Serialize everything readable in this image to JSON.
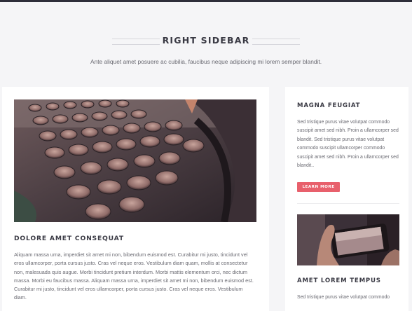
{
  "header": {
    "title": "RIGHT SIDEBAR",
    "subtitle": "Ante aliquet amet posuere ac cubilia, faucibus neque adipiscing mi lorem semper blandit."
  },
  "main": {
    "post_title": "DOLORE AMET CONSEQUAT",
    "post_body": "Aliquam massa urna, imperdiet sit amet mi non, bibendum euismod est. Curabitur mi justo, tincidunt vel eros ullamcorper, porta cursus justo. Cras vel neque eros. Vestibulum diam quam, mollis at consectetur non, malesuada quis augue. Morbi tincidunt pretium interdum. Morbi mattis elementum orci, nec dictum massa. Morbi eu faucibus massa. Aliquam massa urna, imperdiet sit amet mi non, bibendum euismod est. Curabitur mi justo, tincidunt vel eros ullamcorper, porta cursus justo. Cras vel neque eros. Vestibulum diam."
  },
  "sidebar": {
    "widget1": {
      "title": "MAGNA FEUGIAT",
      "text": "Sed tristique purus vitae volutpat commodo suscipit amet sed nibh. Proin a ullamcorper sed blandit. Sed tristique purus vitae volutpat commodo suscipit ullamcorper commodo suscipit amet sed nibh. Proin a ullamcorper sed blandit..",
      "button_label": "LEARN MORE"
    },
    "widget2": {
      "title": "AMET LOREM TEMPUS",
      "text": "Sed tristique purus vitae volutpat commodo"
    }
  },
  "colors": {
    "accent": "#e8606c",
    "heading": "#3a3a44",
    "page_bg": "#f5f5f7"
  }
}
